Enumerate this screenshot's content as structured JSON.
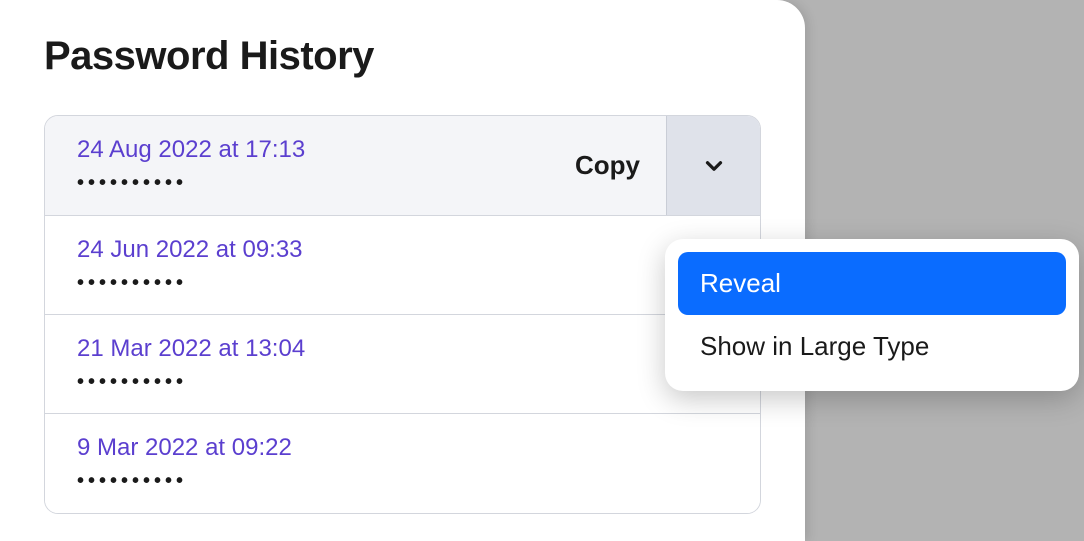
{
  "title": "Password History",
  "rows": [
    {
      "date": "24 Aug 2022 at 17:13",
      "masked": "••••••••••"
    },
    {
      "date": "24 Jun 2022 at 09:33",
      "masked": "••••••••••"
    },
    {
      "date": "21 Mar 2022 at 13:04",
      "masked": "••••••••••"
    },
    {
      "date": "9 Mar 2022 at 09:22",
      "masked": "••••••••••"
    }
  ],
  "actions": {
    "copy_label": "Copy"
  },
  "menu": {
    "reveal": "Reveal",
    "large_type": "Show in Large Type"
  }
}
